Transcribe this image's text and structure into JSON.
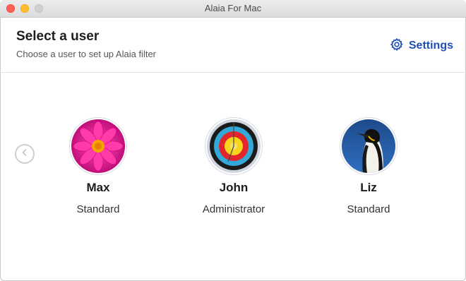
{
  "window": {
    "title": "Alaia For Mac"
  },
  "header": {
    "title": "Select a user",
    "subtitle": "Choose a user to set up Alaia filter",
    "settings_label": "Settings"
  },
  "users": [
    {
      "name": "Max",
      "role": "Standard",
      "avatar": "pink-flower"
    },
    {
      "name": "John",
      "role": "Administrator",
      "avatar": "archery-target"
    },
    {
      "name": "Liz",
      "role": "Standard",
      "avatar": "penguin"
    }
  ],
  "colors": {
    "accent": "#1f4fb3"
  }
}
